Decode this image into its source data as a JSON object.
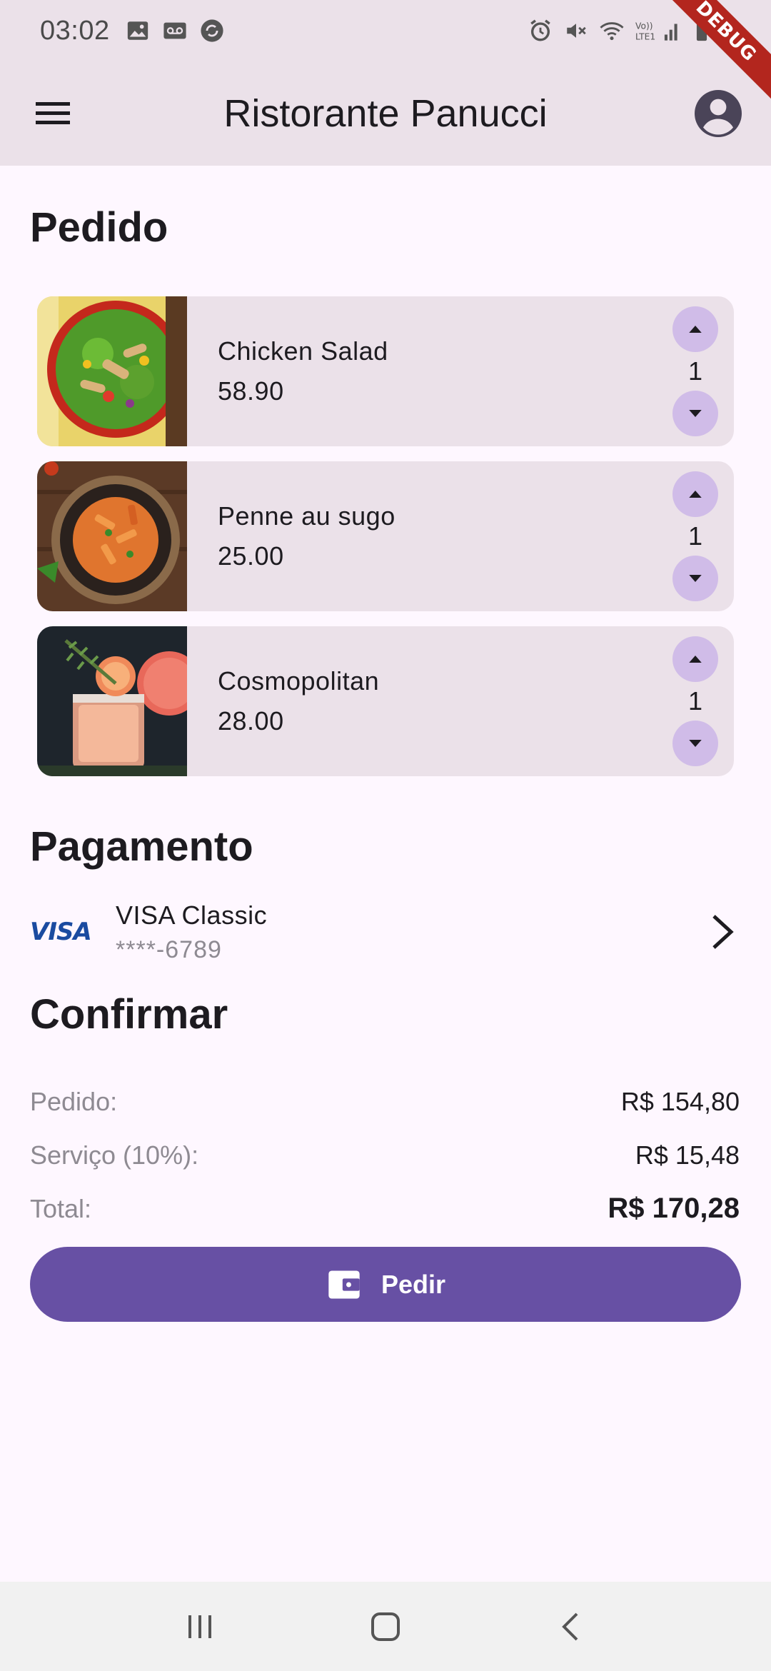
{
  "status_bar": {
    "time": "03:02",
    "left_icons": [
      "image-icon",
      "voicemail-icon",
      "sync-icon"
    ],
    "right_icons": [
      "alarm-icon",
      "mute-icon",
      "wifi-icon",
      "lte-signal-icon",
      "battery-icon"
    ],
    "network_label": "Vo)) LTE1"
  },
  "debug_banner": "DEBUG",
  "app_bar": {
    "title": "Ristorante Panucci",
    "menu_icon": "menu-icon",
    "profile_icon": "account-circle-icon"
  },
  "order": {
    "title": "Pedido",
    "items": [
      {
        "name": "Chicken Salad",
        "price": "58.90",
        "quantity": "1",
        "image": "chicken-salad-photo"
      },
      {
        "name": "Penne au sugo",
        "price": "25.00",
        "quantity": "1",
        "image": "penne-photo"
      },
      {
        "name": "Cosmopolitan",
        "price": "28.00",
        "quantity": "1",
        "image": "cocktail-photo"
      }
    ]
  },
  "payment": {
    "title": "Pagamento",
    "brand": "VISA",
    "card_name": "VISA Classic",
    "card_number": "****-6789"
  },
  "confirm": {
    "title": "Confirmar",
    "rows": [
      {
        "label": "Pedido:",
        "value": "R$ 154,80"
      },
      {
        "label": "Serviço (10%):",
        "value": "R$ 15,48"
      },
      {
        "label": "Total:",
        "value": "R$ 170,28"
      }
    ],
    "button_label": "Pedir",
    "button_icon": "wallet-icon"
  },
  "colors": {
    "app_bar_bg": "#EBE1E9",
    "page_bg": "#FEF7FF",
    "card_bg": "#EBE1E9",
    "qty_button_bg": "#D0BCE8",
    "primary": "#6750A4",
    "muted_text": "#8E8A92"
  }
}
